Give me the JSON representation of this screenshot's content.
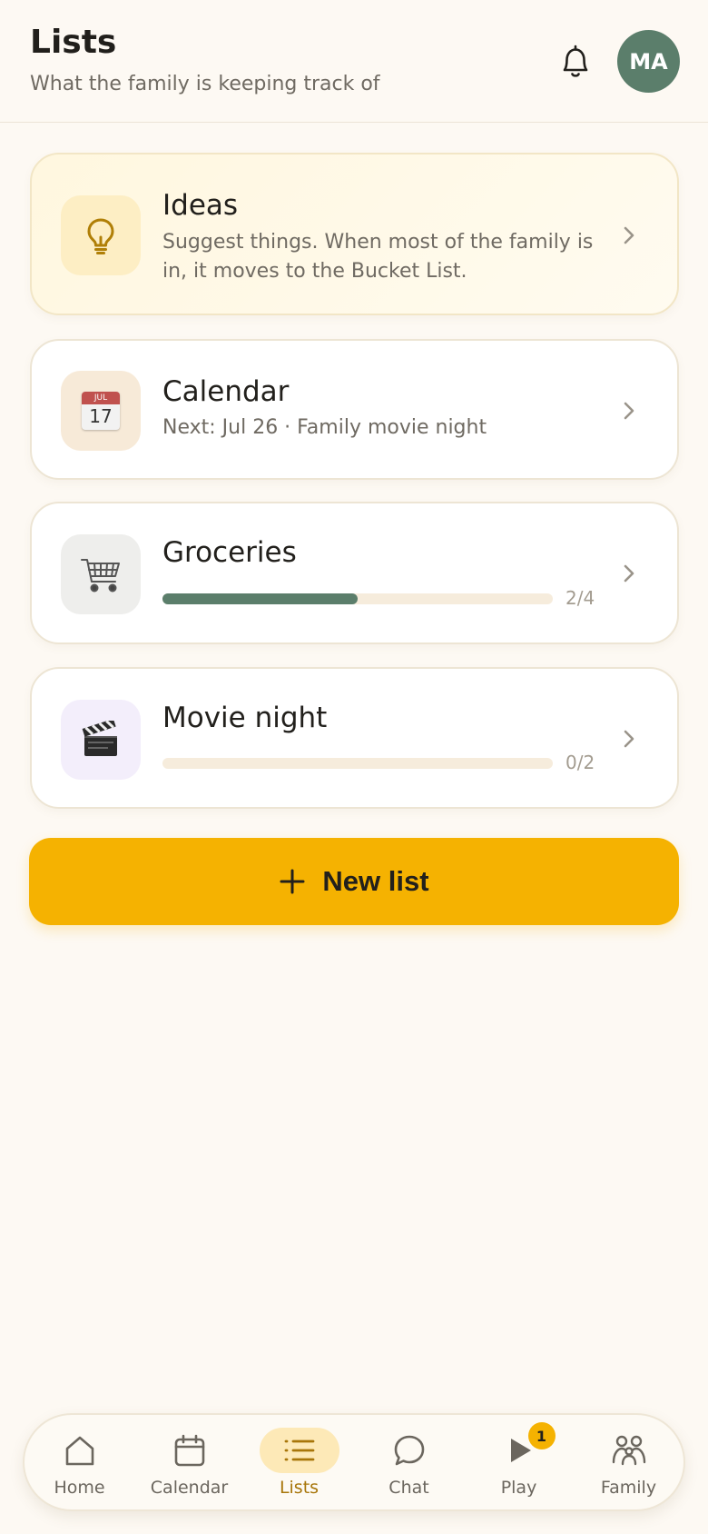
{
  "header": {
    "title": "Lists",
    "subtitle": "What the family is keeping track of",
    "avatar_initials": "MA"
  },
  "lists": [
    {
      "title": "Ideas",
      "description": "Suggest things. When most of the family is in, it moves to the Bucket List.",
      "icon": "lightbulb-icon"
    },
    {
      "title": "Calendar",
      "description": "Next: Jul 26 · Family movie night",
      "icon": "calendar-emoji-icon",
      "icon_month": "JUL",
      "icon_day": "17"
    },
    {
      "title": "Groceries",
      "icon": "shopping-cart-icon",
      "progress": {
        "done": 2,
        "total": 4,
        "label": "2/4"
      }
    },
    {
      "title": "Movie night",
      "icon": "clapper-board-icon",
      "progress": {
        "done": 0,
        "total": 2,
        "label": "0/2"
      }
    }
  ],
  "new_list_button": {
    "label": "New list",
    "icon": "plus-icon"
  },
  "nav": [
    {
      "label": "Home",
      "icon": "home-icon"
    },
    {
      "label": "Calendar",
      "icon": "calendar-icon"
    },
    {
      "label": "Lists",
      "icon": "list-icon",
      "active": true
    },
    {
      "label": "Chat",
      "icon": "chat-bubble-icon"
    },
    {
      "label": "Play",
      "icon": "play-icon",
      "badge": "1"
    },
    {
      "label": "Family",
      "icon": "family-icon"
    }
  ],
  "colors": {
    "background": "#fdf9f3",
    "accent": "#f5b201",
    "green": "#5b7e6b",
    "active_nav_pill": "#fde9b7",
    "active_nav_text": "#a8760a"
  }
}
